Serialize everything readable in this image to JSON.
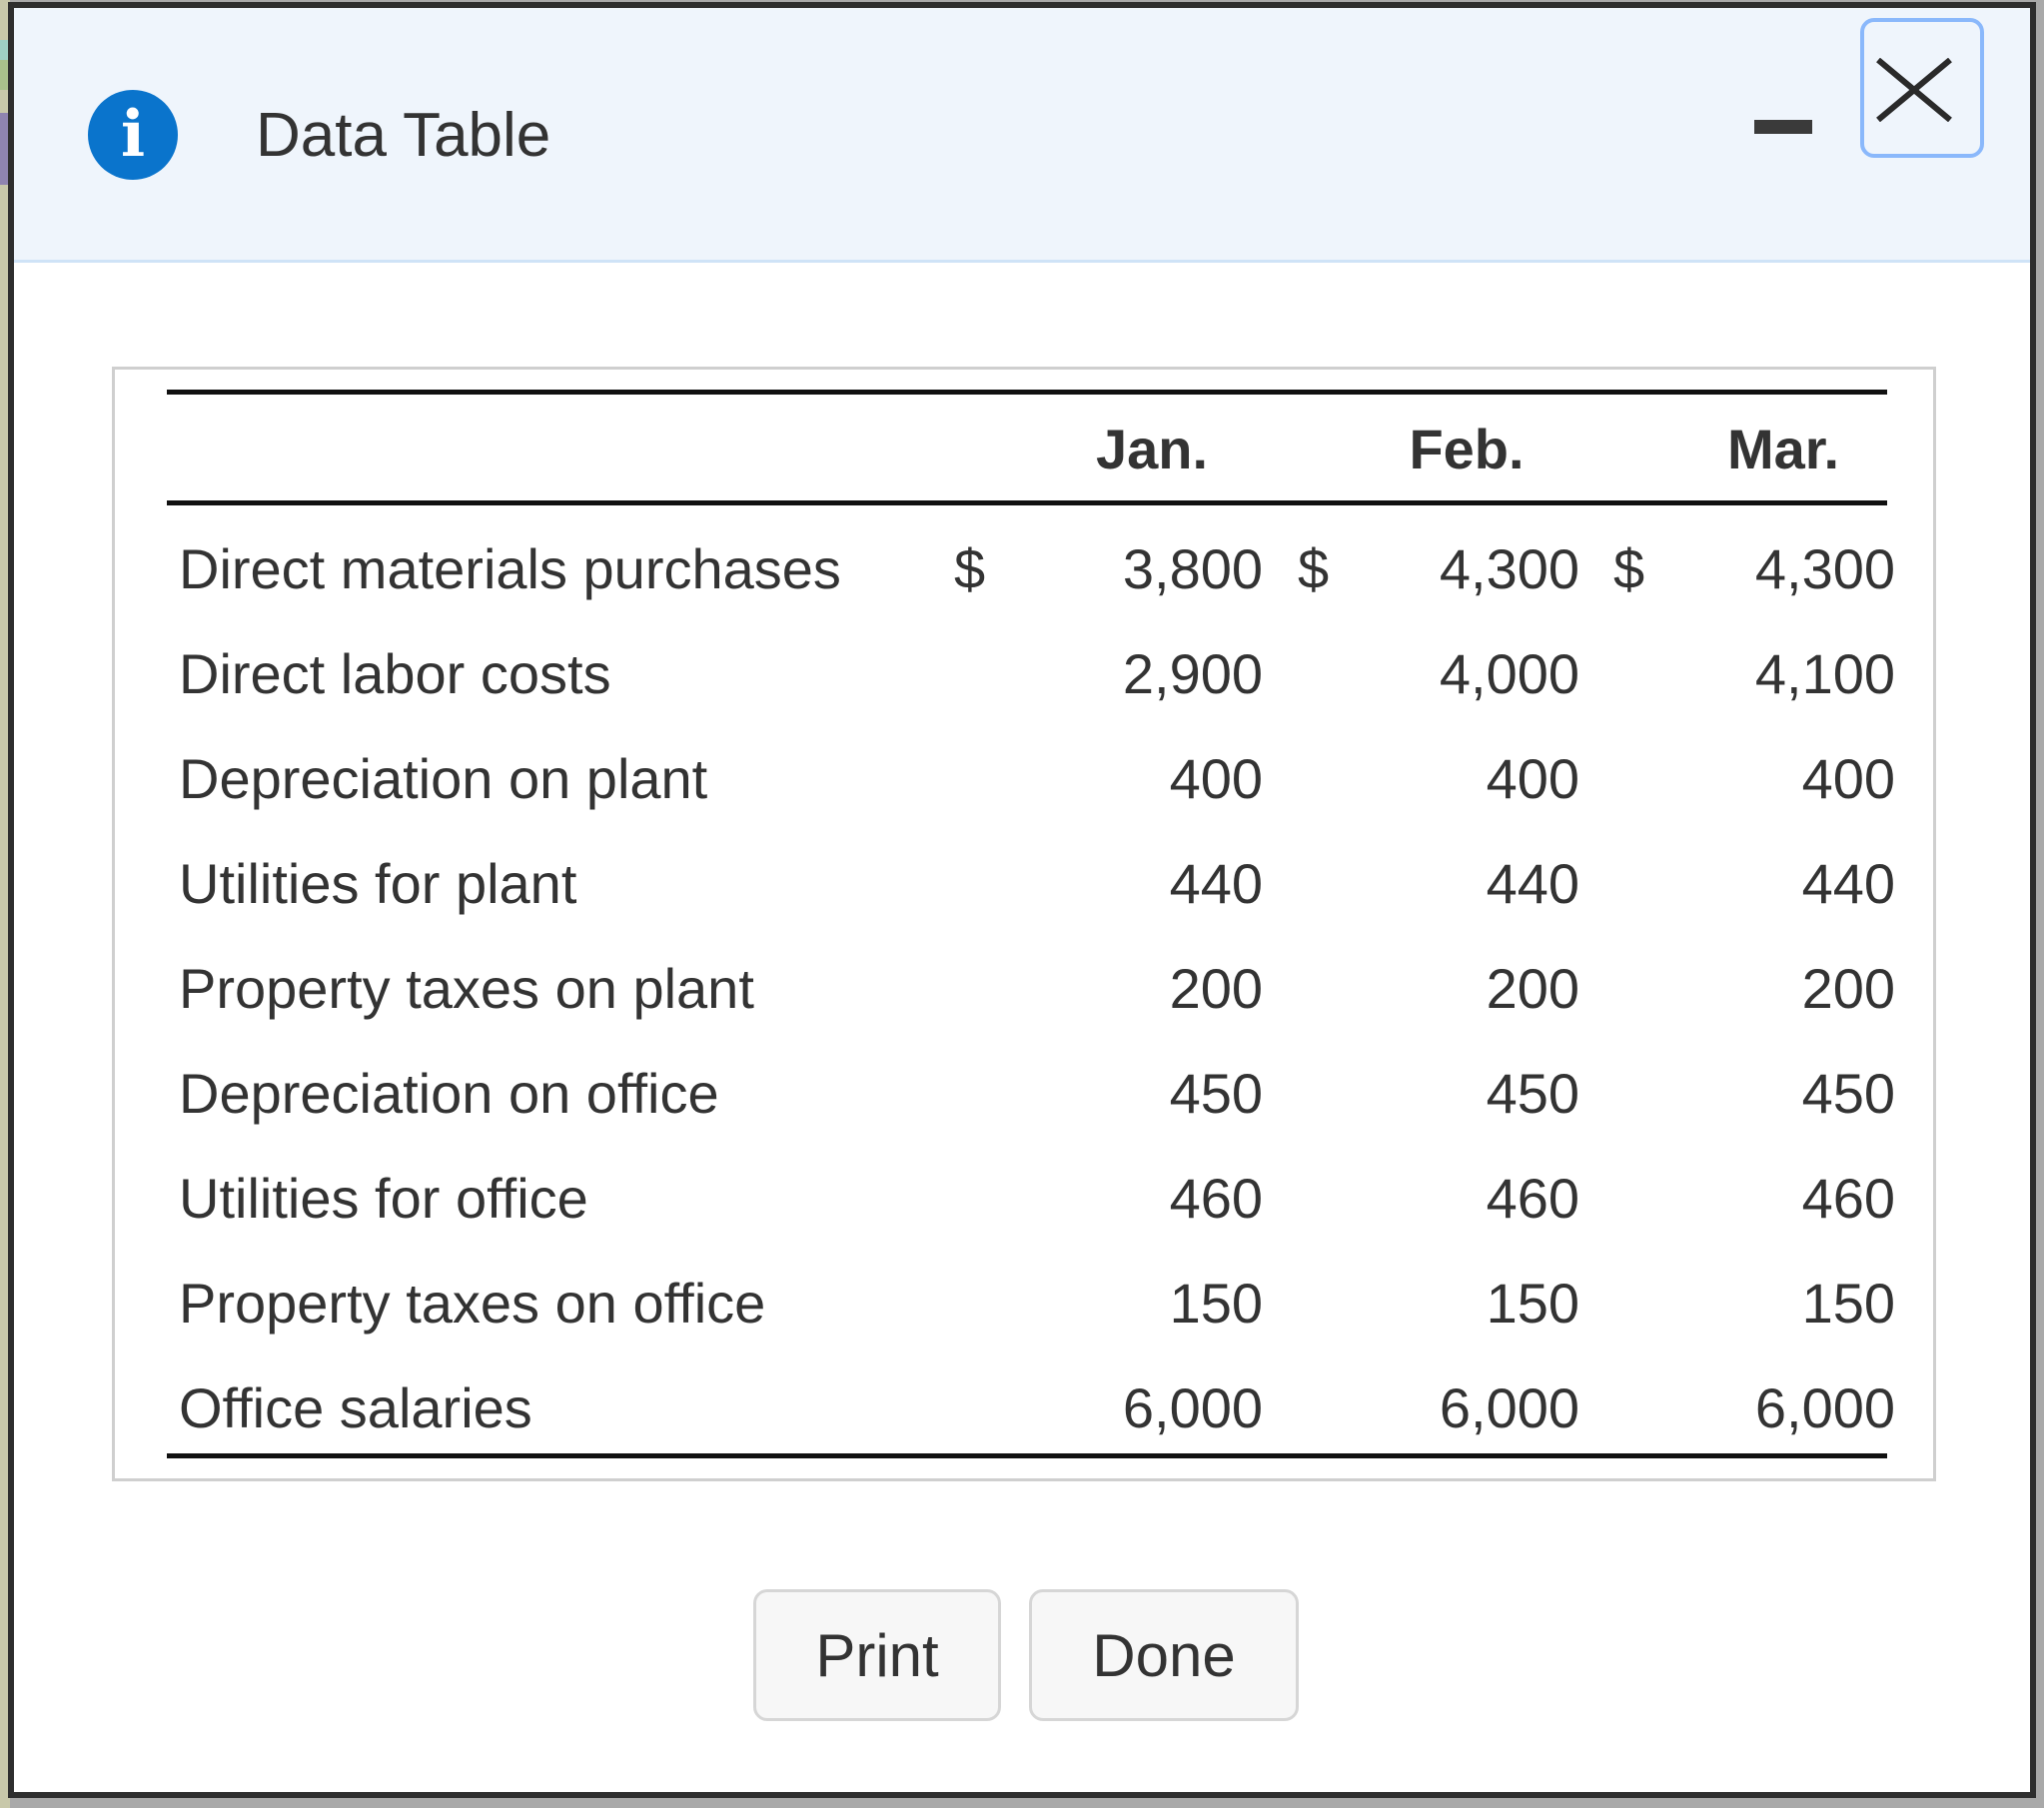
{
  "dialog": {
    "title": "Data Table",
    "info_icon_glyph": "i",
    "minimize_icon": "minimize-icon",
    "close_icon": "close-icon"
  },
  "table": {
    "columns": [
      "Jan.",
      "Feb.",
      "Mar."
    ],
    "currency_symbol": "$",
    "rows": [
      {
        "label": "Direct materials purchases",
        "values": [
          "3,800",
          "4,300",
          "4,300"
        ],
        "show_currency": true
      },
      {
        "label": "Direct labor costs",
        "values": [
          "2,900",
          "4,000",
          "4,100"
        ],
        "show_currency": false
      },
      {
        "label": "Depreciation on plant",
        "values": [
          "400",
          "400",
          "400"
        ],
        "show_currency": false
      },
      {
        "label": "Utilities for plant",
        "values": [
          "440",
          "440",
          "440"
        ],
        "show_currency": false
      },
      {
        "label": "Property taxes on plant",
        "values": [
          "200",
          "200",
          "200"
        ],
        "show_currency": false
      },
      {
        "label": "Depreciation on office",
        "values": [
          "450",
          "450",
          "450"
        ],
        "show_currency": false
      },
      {
        "label": "Utilities for office",
        "values": [
          "460",
          "460",
          "460"
        ],
        "show_currency": false
      },
      {
        "label": "Property taxes on office",
        "values": [
          "150",
          "150",
          "150"
        ],
        "show_currency": false
      },
      {
        "label": "Office salaries",
        "values": [
          "6,000",
          "6,000",
          "6,000"
        ],
        "show_currency": false
      }
    ]
  },
  "buttons": {
    "print_label": "Print",
    "done_label": "Done"
  },
  "colors": {
    "info_icon": "#0a74cc",
    "header_bg": "#eff5fc",
    "close_focus_ring": "#8ab8fb"
  }
}
